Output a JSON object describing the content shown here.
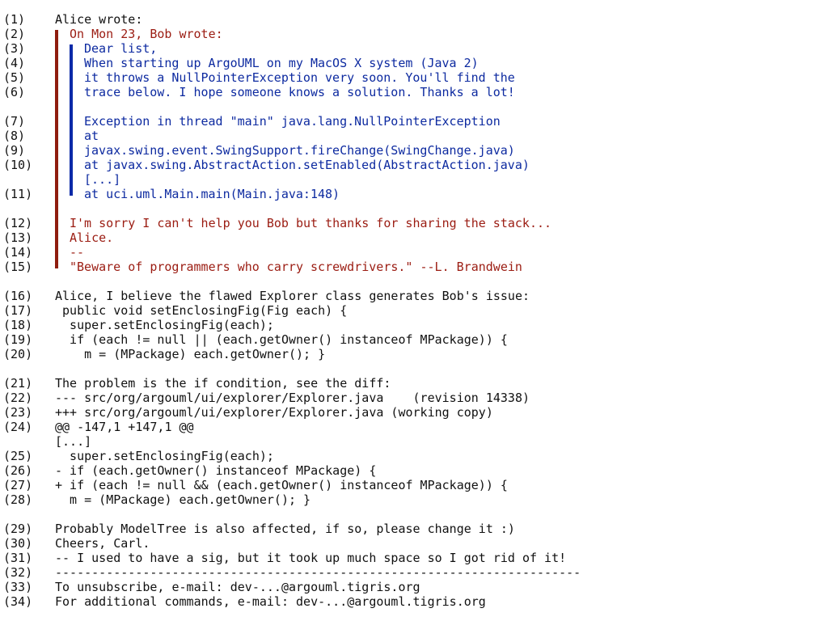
{
  "colors": {
    "text": "#111111",
    "quote_level_1": "#9b1c12",
    "quote_level_2": "#0d2aa0",
    "bar_level_1": "#8f1d0f",
    "bar_level_2": "#0b2aa8"
  },
  "lines": [
    {
      "num": "(1)",
      "text": "Alice wrote:",
      "level": 0
    },
    {
      "num": "(2)",
      "text": "On Mon 23, Bob wrote:",
      "level": 1
    },
    {
      "num": "(3)",
      "text": "Dear list,",
      "level": 2
    },
    {
      "num": "(4)",
      "text": "When starting up ArgoUML on my MacOS X system (Java 2)",
      "level": 2
    },
    {
      "num": "(5)",
      "text": "it throws a NullPointerException very soon. You'll find the",
      "level": 2
    },
    {
      "num": "(6)",
      "text": "trace below. I hope someone knows a solution. Thanks a lot!",
      "level": 2
    },
    {
      "gap": true
    },
    {
      "num": "(7)",
      "text": "Exception in thread \"main\" java.lang.NullPointerException",
      "level": 2
    },
    {
      "num": "(8)",
      "text": "at",
      "level": 2
    },
    {
      "num": "(9)",
      "text": "javax.swing.event.SwingSupport.fireChange(SwingChange.java)",
      "level": 2
    },
    {
      "num": "(10)",
      "text": "at javax.swing.AbstractAction.setEnabled(AbstractAction.java)",
      "level": 2
    },
    {
      "num": "",
      "text": "[...]",
      "level": 2
    },
    {
      "num": "(11)",
      "text": "at uci.uml.Main.main(Main.java:148)",
      "level": 2
    },
    {
      "gap": true
    },
    {
      "num": "(12)",
      "text": "I'm sorry I can't help you Bob but thanks for sharing the stack...",
      "level": 1
    },
    {
      "num": "(13)",
      "text": "Alice.",
      "level": 1
    },
    {
      "num": "(14)",
      "text": "--",
      "level": 1
    },
    {
      "num": "(15)",
      "text": "\"Beware of programmers who carry screwdrivers.\" --L. Brandwein",
      "level": 1
    },
    {
      "gap": true
    },
    {
      "num": "(16)",
      "text": "Alice, I believe the flawed Explorer class generates Bob's issue:",
      "level": 0
    },
    {
      "num": "(17)",
      "text": " public void setEnclosingFig(Fig each) {",
      "level": 0
    },
    {
      "num": "(18)",
      "text": "  super.setEnclosingFig(each);",
      "level": 0
    },
    {
      "num": "(19)",
      "text": "  if (each != null || (each.getOwner() instanceof MPackage)) {",
      "level": 0
    },
    {
      "num": "(20)",
      "text": "    m = (MPackage) each.getOwner(); }",
      "level": 0
    },
    {
      "gap": true
    },
    {
      "num": "(21)",
      "text": "The problem is the if condition, see the diff:",
      "level": 0
    },
    {
      "num": "(22)",
      "text": "--- src/org/argouml/ui/explorer/Explorer.java    (revision 14338)",
      "level": 0
    },
    {
      "num": "(23)",
      "text": "+++ src/org/argouml/ui/explorer/Explorer.java (working copy)",
      "level": 0
    },
    {
      "num": "(24)",
      "text": "@@ -147,1 +147,1 @@",
      "level": 0
    },
    {
      "num": "",
      "text": "[...]",
      "level": 0
    },
    {
      "num": "(25)",
      "text": "  super.setEnclosingFig(each);",
      "level": 0
    },
    {
      "num": "(26)",
      "text": "- if (each.getOwner() instanceof MPackage) {",
      "level": 0
    },
    {
      "num": "(27)",
      "text": "+ if (each != null && (each.getOwner() instanceof MPackage)) {",
      "level": 0
    },
    {
      "num": "(28)",
      "text": "  m = (MPackage) each.getOwner(); }",
      "level": 0
    },
    {
      "gap": true
    },
    {
      "num": "(29)",
      "text": "Probably ModelTree is also affected, if so, please change it :)",
      "level": 0
    },
    {
      "num": "(30)",
      "text": "Cheers, Carl.",
      "level": 0
    },
    {
      "num": "(31)",
      "text": "-- I used to have a sig, but it took up much space so I got rid of it!",
      "level": 0
    },
    {
      "num": "(32)",
      "text": "------------------------------------------------------------------------",
      "level": 0
    },
    {
      "num": "(33)",
      "text": "To unsubscribe, e-mail: dev-...@argouml.tigris.org",
      "level": 0
    },
    {
      "num": "(34)",
      "text": "For additional commands, e-mail: dev-...@argouml.tigris.org",
      "level": 0
    }
  ]
}
